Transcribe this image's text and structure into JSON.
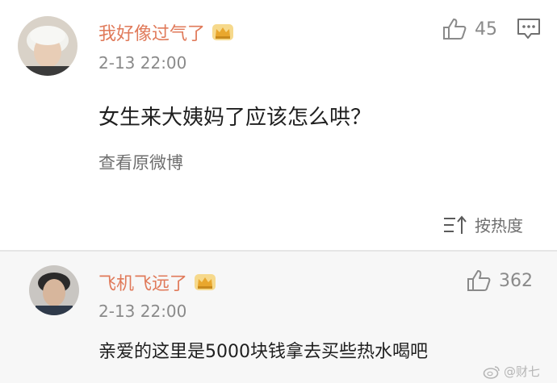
{
  "post": {
    "username": "我好像过气了",
    "timestamp": "2-13 22:00",
    "like_count": "45",
    "content": "女生来大姨妈了应该怎么哄？",
    "view_original_label": "查看原微博",
    "sort_label": "按热度",
    "badge_icon": "crown-badge-icon",
    "like_icon": "thumbs-up-icon",
    "comment_icon": "comment-icon",
    "sort_icon": "sort-icon"
  },
  "reply": {
    "username": "飞机飞远了",
    "timestamp": "2-13 22:00",
    "like_count": "362",
    "content": "亲爱的这里是5000块钱拿去买些热水喝吧",
    "badge_icon": "crown-badge-icon",
    "like_icon": "thumbs-up-icon"
  },
  "watermark": {
    "text": "@财七",
    "icon": "weibo-logo-icon"
  },
  "colors": {
    "username": "#e07a5a",
    "timestamp": "#8a8a8a",
    "reply_background": "#f7f7f7",
    "divider": "#e6e6e6"
  }
}
